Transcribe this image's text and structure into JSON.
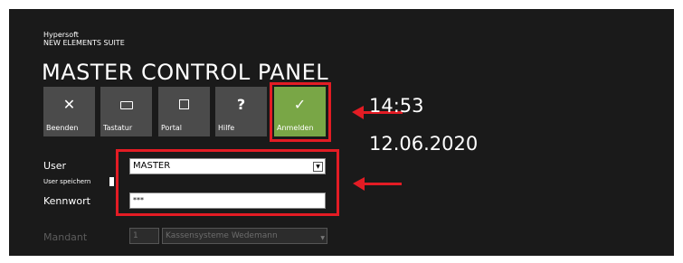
{
  "brand": {
    "company": "Hypersoft",
    "suite": "NEW ELEMENTS SUITE"
  },
  "title": "MASTER CONTROL PANEL",
  "toolbar": {
    "buttons": [
      {
        "label": "Beenden",
        "icon": "close-icon"
      },
      {
        "label": "Tastatur",
        "icon": "keyboard-icon"
      },
      {
        "label": "Portal",
        "icon": "portal-icon"
      },
      {
        "label": "Hilfe",
        "icon": "help-icon"
      },
      {
        "label": "Anmelden",
        "icon": "check-icon"
      }
    ]
  },
  "clock": {
    "time": "14:53",
    "date": "12.06.2020"
  },
  "login": {
    "user_label": "User",
    "user_value": "MASTER",
    "remember_label": "User speichern",
    "password_label": "Kennwort",
    "password_value": "***"
  },
  "mandant": {
    "label": "Mandant",
    "number": "1",
    "name": "Kassensysteme Wedemann"
  },
  "colors": {
    "background": "#1a1a1a",
    "tile": "#4b4b4b",
    "login_tile": "#79a646",
    "highlight": "#e31c24"
  }
}
